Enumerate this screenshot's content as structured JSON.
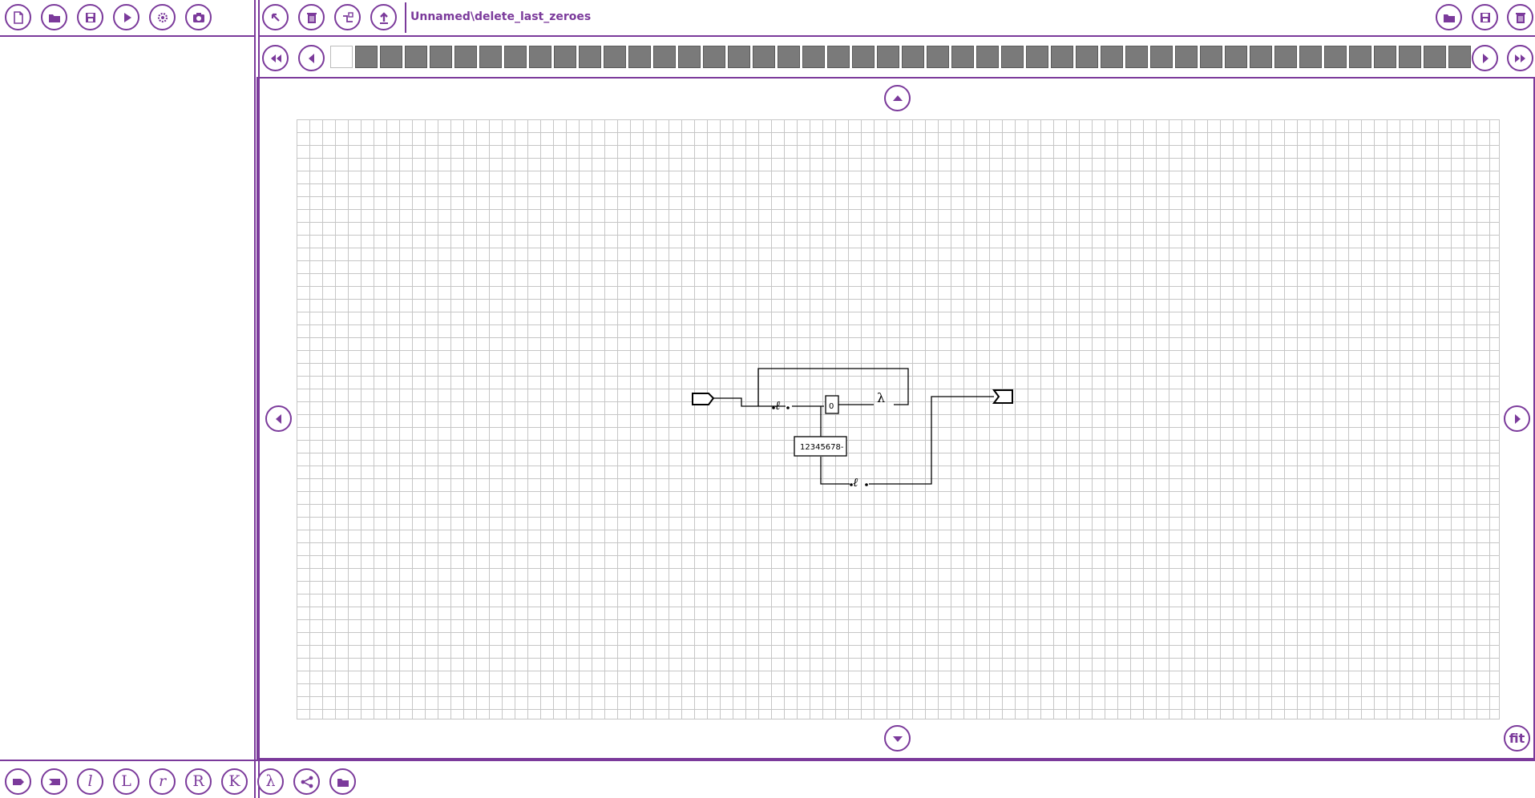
{
  "toolbar_left": {
    "buttons": [
      {
        "name": "new-file-button",
        "icon": "new-file-icon"
      },
      {
        "name": "open-folder-button",
        "icon": "folder-icon"
      },
      {
        "name": "save-button",
        "icon": "save-icon"
      },
      {
        "name": "run-button",
        "icon": "play-icon"
      },
      {
        "name": "settings-button",
        "icon": "gear-icon"
      },
      {
        "name": "screenshot-button",
        "icon": "camera-icon"
      }
    ]
  },
  "toolbar_center": {
    "buttons": [
      {
        "name": "pointer-tool-button",
        "icon": "arrow-pointer-icon"
      },
      {
        "name": "delete-button",
        "icon": "trash-icon"
      },
      {
        "name": "step-into-button",
        "icon": "step-icon"
      },
      {
        "name": "upload-button",
        "icon": "upload-icon"
      }
    ],
    "path": "Unnamed\\delete_last_zeroes"
  },
  "toolbar_right": {
    "buttons": [
      {
        "name": "open-machine-button",
        "icon": "folder-icon"
      },
      {
        "name": "save-machine-button",
        "icon": "save-icon"
      },
      {
        "name": "delete-machine-button",
        "icon": "trash-icon"
      }
    ]
  },
  "tape": {
    "controls": [
      "rewind-left",
      "step-left",
      "step-right",
      "fast-forward-right"
    ],
    "blank_cells": 1,
    "filled_cells": 45
  },
  "canvas": {
    "nav": [
      "pan-up",
      "pan-down",
      "pan-left",
      "pan-right"
    ],
    "fit_label": "fit",
    "node_zero": "0",
    "node_digits": "12345678-",
    "lambda": "λ"
  },
  "bottom_toolbar": {
    "buttons": [
      {
        "name": "start-node-button",
        "icon": "start-tag-icon",
        "label": ""
      },
      {
        "name": "end-node-button",
        "icon": "end-tag-icon",
        "label": ""
      },
      {
        "name": "l-node-button",
        "icon": "l-script-icon",
        "label": "l"
      },
      {
        "name": "L-node-button",
        "icon": "L-icon",
        "label": "L"
      },
      {
        "name": "r-node-button",
        "icon": "r-script-icon",
        "label": "r"
      },
      {
        "name": "R-node-button",
        "icon": "R-icon",
        "label": "R"
      },
      {
        "name": "K-node-button",
        "icon": "K-icon",
        "label": "K"
      },
      {
        "name": "lambda-node-button",
        "icon": "lambda-icon",
        "label": "λ"
      },
      {
        "name": "share-button",
        "icon": "share-icon",
        "label": ""
      },
      {
        "name": "import-button",
        "icon": "folder-icon",
        "label": ""
      }
    ]
  },
  "colors": {
    "accent": "#7b3a9b",
    "grid": "#c6c6c6",
    "tape_cell": "#7a7a7a"
  }
}
